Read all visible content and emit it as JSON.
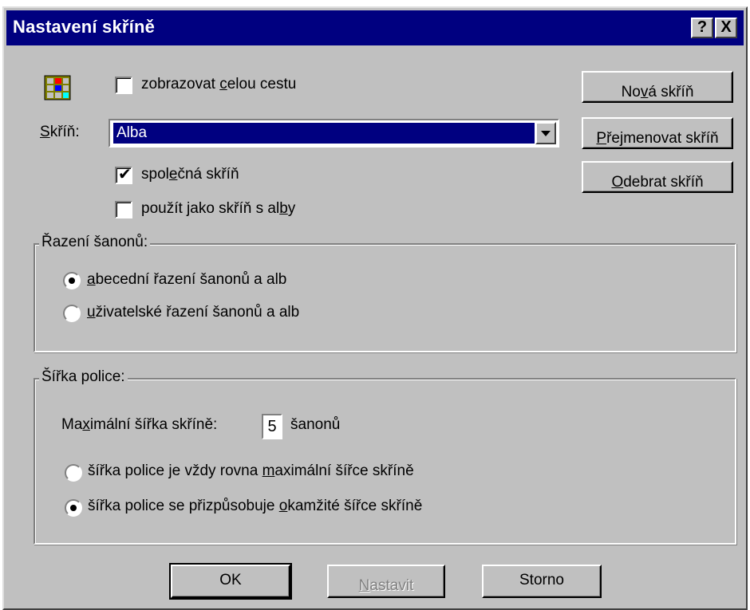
{
  "dialog": {
    "title": "Nastavení skříně",
    "help_button": "?",
    "close_button": "X"
  },
  "options": {
    "show_full_path": {
      "label_pre": "zobrazovat ",
      "label_key": "c",
      "label_post": "elou cestu",
      "checked": false
    },
    "shared_cabinet": {
      "label_pre": "spol",
      "label_key": "e",
      "label_post": "čná skříň",
      "checked": true
    },
    "use_as_album_cabinet": {
      "label_pre": "použít jako skříň s al",
      "label_key": "b",
      "label_post": "y",
      "checked": false
    }
  },
  "cabinet": {
    "label_key": "S",
    "label_post": "kříň:",
    "selected_value": "Alba"
  },
  "buttons": {
    "new_cabinet": {
      "pre": "No",
      "key": "v",
      "post": "á skříň"
    },
    "rename_cabinet": {
      "pre": "",
      "key": "P",
      "post": "řejmenovat skříň"
    },
    "remove_cabinet": {
      "pre": "",
      "key": "O",
      "post": "debrat skříň"
    },
    "ok": "OK",
    "apply": {
      "pre": "",
      "key": "N",
      "post": "astavit"
    },
    "cancel": "Storno"
  },
  "sorting_group": {
    "title": "Řazení šanonů:",
    "alphabetical": {
      "key": "a",
      "post": "becední řazení šanonů a alb",
      "selected": true
    },
    "user_defined": {
      "key": "u",
      "post": "živatelské řazení šanonů a alb",
      "selected": false
    }
  },
  "shelf_group": {
    "title": "Šířka police:",
    "max_width_pre": "Ma",
    "max_width_key": "x",
    "max_width_post": "imální šířka skříně:",
    "max_width_value": "5",
    "max_width_unit": "šanonů",
    "always_max": {
      "pre": "šířka police je vždy rovna ",
      "key": "m",
      "post": "aximální šířce skříně",
      "selected": false
    },
    "adapt": {
      "pre": "šířka police se přizpůsobuje ",
      "key": "o",
      "post": "kamžité šířce skříně",
      "selected": true
    }
  }
}
